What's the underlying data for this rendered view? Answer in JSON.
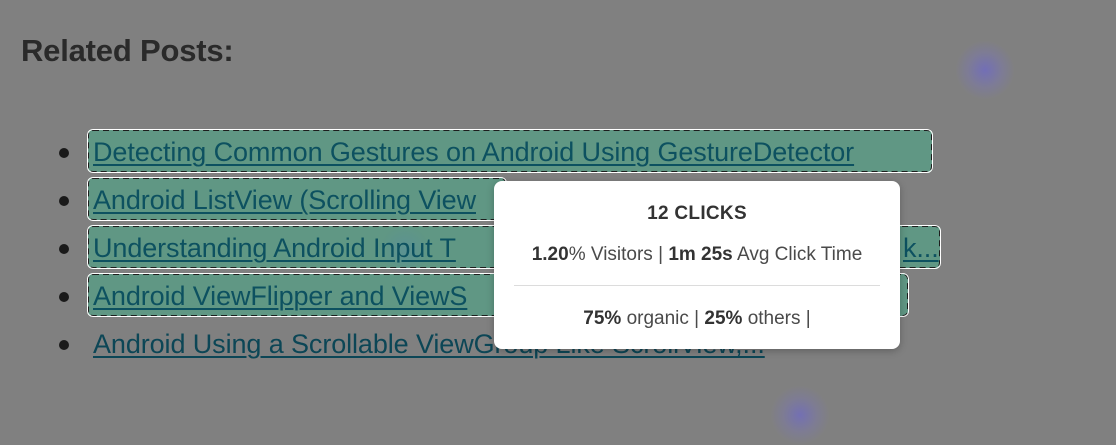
{
  "heading": "Related Posts:",
  "posts": [
    {
      "label": "Detecting Common Gestures on Android Using GestureDetector",
      "highlighted": true
    },
    {
      "label": "Android ListView (Scrolling View",
      "highlighted": true
    },
    {
      "label": "Understanding Android Input T",
      "highlighted": true,
      "trailing": "k..."
    },
    {
      "label": "Android ViewFlipper and ViewS",
      "highlighted": true
    },
    {
      "label": "Android Using a Scrollable ViewGroup Like ScrollView,...",
      "highlighted": false
    }
  ],
  "tooltip": {
    "title": "12 CLICKS",
    "visitors_value": "1.20",
    "visitors_suffix": "% Visitors | ",
    "avg_time_value": "1m 25s",
    "avg_time_label": " Avg Click Time",
    "organic_value": "75%",
    "organic_label": " organic | ",
    "others_value": "25%",
    "others_label": " others |"
  },
  "colors": {
    "background": "#808080",
    "highlight": "#46aa87",
    "link": "#0d5160"
  }
}
